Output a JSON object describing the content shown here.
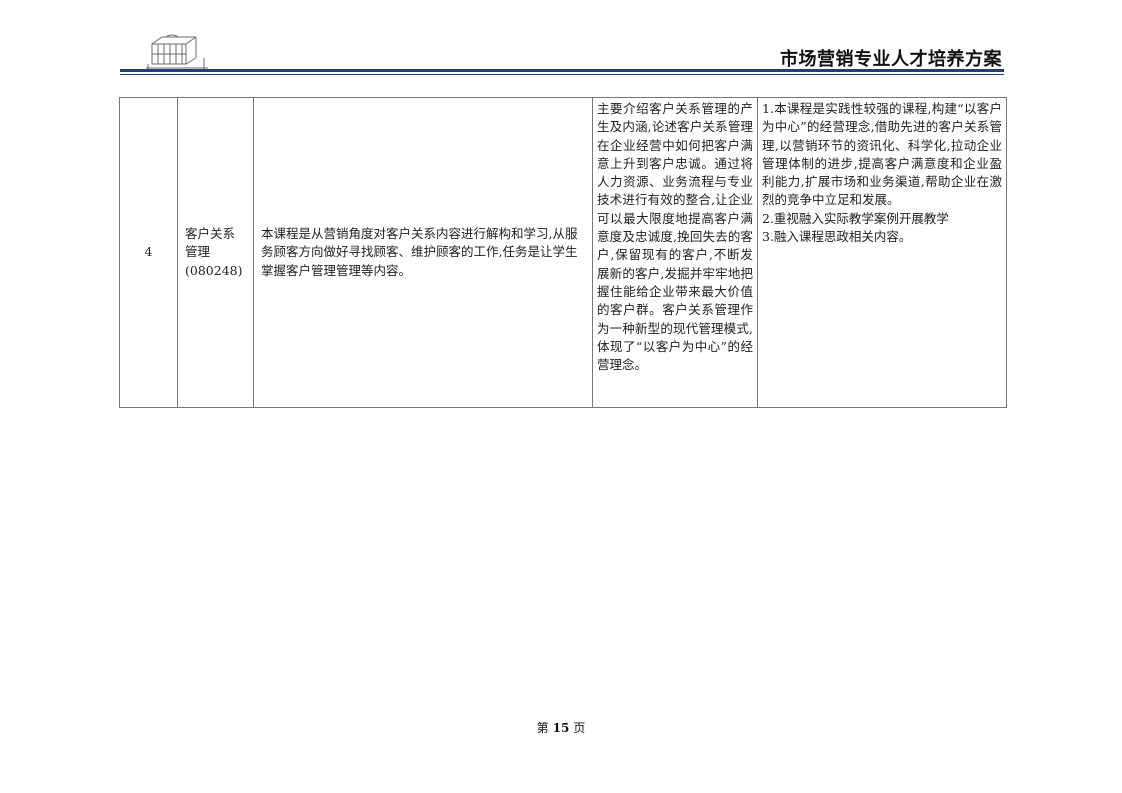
{
  "header": {
    "title": "市场营销专业人才培养方案",
    "logo_icon": "loom-machine-logo",
    "rule_color": "#1f3f77"
  },
  "course_row": {
    "number": "4",
    "name_line1": "客户关系",
    "name_line2": "管理",
    "code": "(080248)",
    "objective": "本课程是从营销角度对客户关系内容进行解构和学习,从服务顾客方向做好寻找顾客、维护顾客的工作,任务是让学生掌握客户管理管理等内容。",
    "content": "主要介绍客户关系管理的产生及内涵,论述客户关系管理在企业经营中如何把客户满意上升到客户忠诚。通过将人力资源、业务流程与专业技术进行有效的整合,让企业可以最大限度地提高客户满意度及忠诚度,挽回失去的客户,保留现有的客户,不断发展新的客户,发掘并牢牢地把握住能给企业带来最大价值的客户群。客户关系管理作为一种新型的现代管理模式,体现了“以客户为中心”的经营理念。",
    "requirements": [
      "1.本课程是实践性较强的课程,构建“以客户为中心”的经营理念,借助先进的客户关系管理,以营销环节的资讯化、科学化,拉动企业管理体制的进步,提高客户满意度和企业盈利能力,扩展市场和业务渠道,帮助企业在激烈的竞争中立足和发展。",
      "2.重视融入实际教学案例开展教学",
      "3.融入课程思政相关内容。"
    ]
  },
  "footer": {
    "prefix": "第",
    "page_number": "15",
    "suffix": "页"
  }
}
